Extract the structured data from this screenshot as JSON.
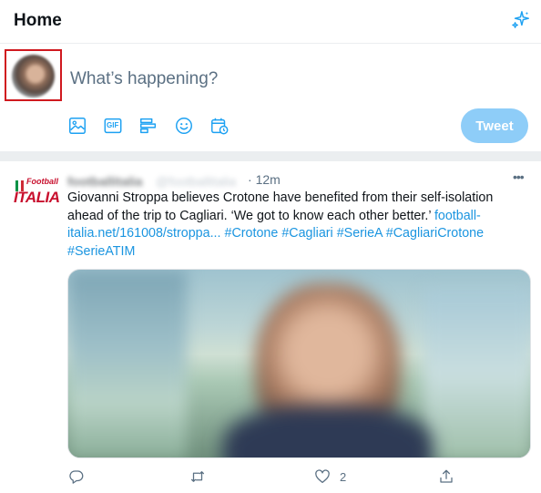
{
  "header": {
    "title": "Home",
    "icon": "sparkle-icon"
  },
  "composer": {
    "placeholder": "What’s happening?",
    "tools": [
      "image-icon",
      "gif-icon",
      "poll-icon",
      "emoji-icon",
      "schedule-icon"
    ],
    "gif_label": "GIF",
    "tweet_label": "Tweet"
  },
  "tweet": {
    "author_logo_small": "Football",
    "author_logo_big": "ITALIA",
    "author_name": "footballitalia",
    "author_handle": "@footballitalia",
    "separator": "·",
    "time": "12m",
    "more": "•••",
    "text_plain": "Giovanni Stroppa believes Crotone have benefited from their self-isolation ahead of the trip to Cagliari. ‘We got to know each other better.’ ",
    "link_url": "football-italia.net/161008/stroppa...",
    "hashtags": [
      "#Crotone",
      "#Cagliari",
      "#SerieA",
      "#CagliariCrotone",
      "#SerieATIM"
    ],
    "actions": {
      "reply": "reply-icon",
      "retweet": "retweet-icon",
      "like": "like-icon",
      "share": "share-icon"
    },
    "like_count": "2"
  },
  "colors": {
    "accent": "#1da1f2",
    "link": "#1b95e0",
    "tweet_button_disabled": "#8ecdf8",
    "highlight_box": "#d0191f",
    "divider": "#ebeef0"
  }
}
